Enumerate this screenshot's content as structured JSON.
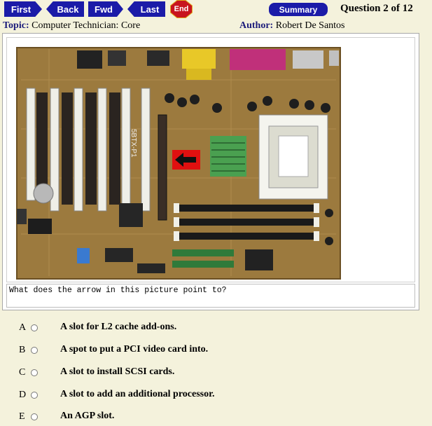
{
  "nav": {
    "first": "First",
    "back": "Back",
    "fwd": "Fwd",
    "last": "Last",
    "end": "End",
    "summary": "Summary"
  },
  "question_counter": "Question 2 of 12",
  "topic": {
    "label": "Topic:",
    "value": "Computer Technician: Core"
  },
  "author": {
    "label": "Author:",
    "value": "Robert De Santos"
  },
  "image": {
    "board_text": "5BTX-P1",
    "arrow_color": "#e01010"
  },
  "question": "What does the arrow in this picture point to?",
  "options": [
    {
      "letter": "A",
      "text": "A slot for L2 cache add-ons."
    },
    {
      "letter": "B",
      "text": "A spot to put a PCI video card into."
    },
    {
      "letter": "C",
      "text": "A slot to install SCSI cards."
    },
    {
      "letter": "D",
      "text": "A slot to add an additional processor."
    },
    {
      "letter": "E",
      "text": "An AGP slot."
    }
  ]
}
